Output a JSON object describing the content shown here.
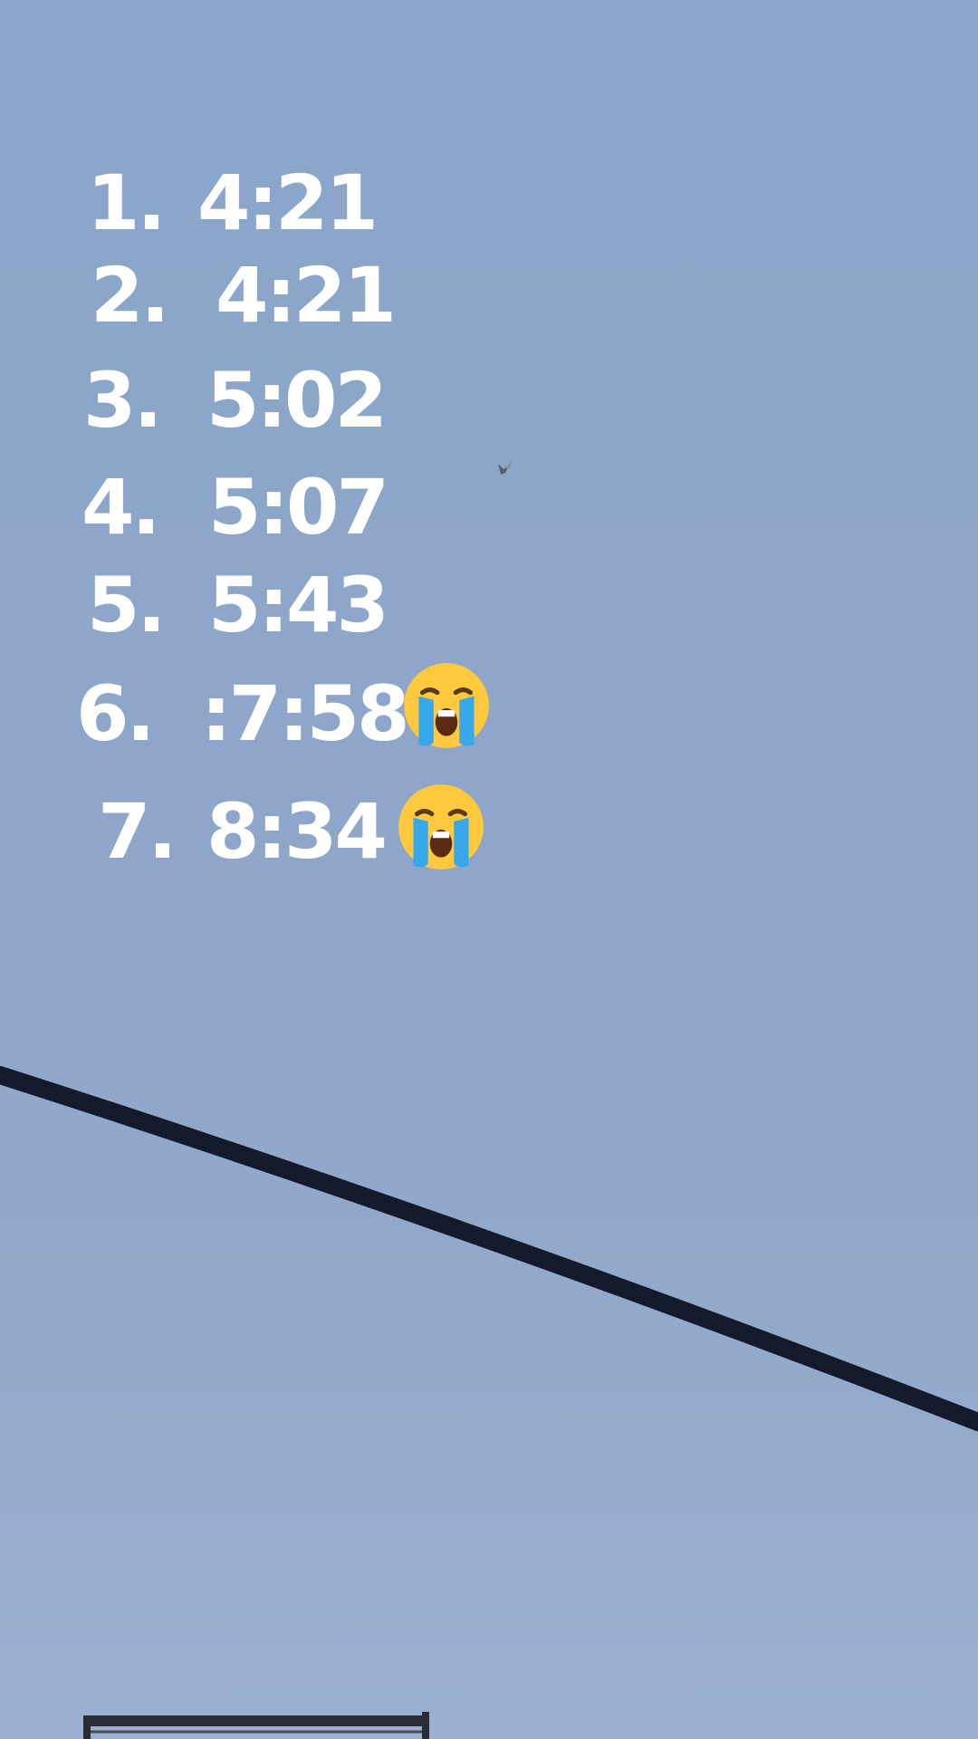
{
  "list": [
    {
      "number": "1.",
      "time": "4:21",
      "emoji": false
    },
    {
      "number": "2.",
      "time": "4:21",
      "emoji": false
    },
    {
      "number": "3.",
      "time": "5:02",
      "emoji": false
    },
    {
      "number": "4.",
      "time": "5:07",
      "emoji": false
    },
    {
      "number": "5.",
      "time": "5:43",
      "emoji": false
    },
    {
      "number": "6.",
      "time": ":7:58",
      "emoji": true
    },
    {
      "number": "7.",
      "time": "8:34",
      "emoji": true
    }
  ],
  "emoji_name": "loudly-crying-face-icon",
  "colors": {
    "sky": "#8ea6c9",
    "text": "#ffffff",
    "wire": "#121a2c",
    "emoji_face": "#ffc83d",
    "emoji_tears": "#37a8ea"
  }
}
